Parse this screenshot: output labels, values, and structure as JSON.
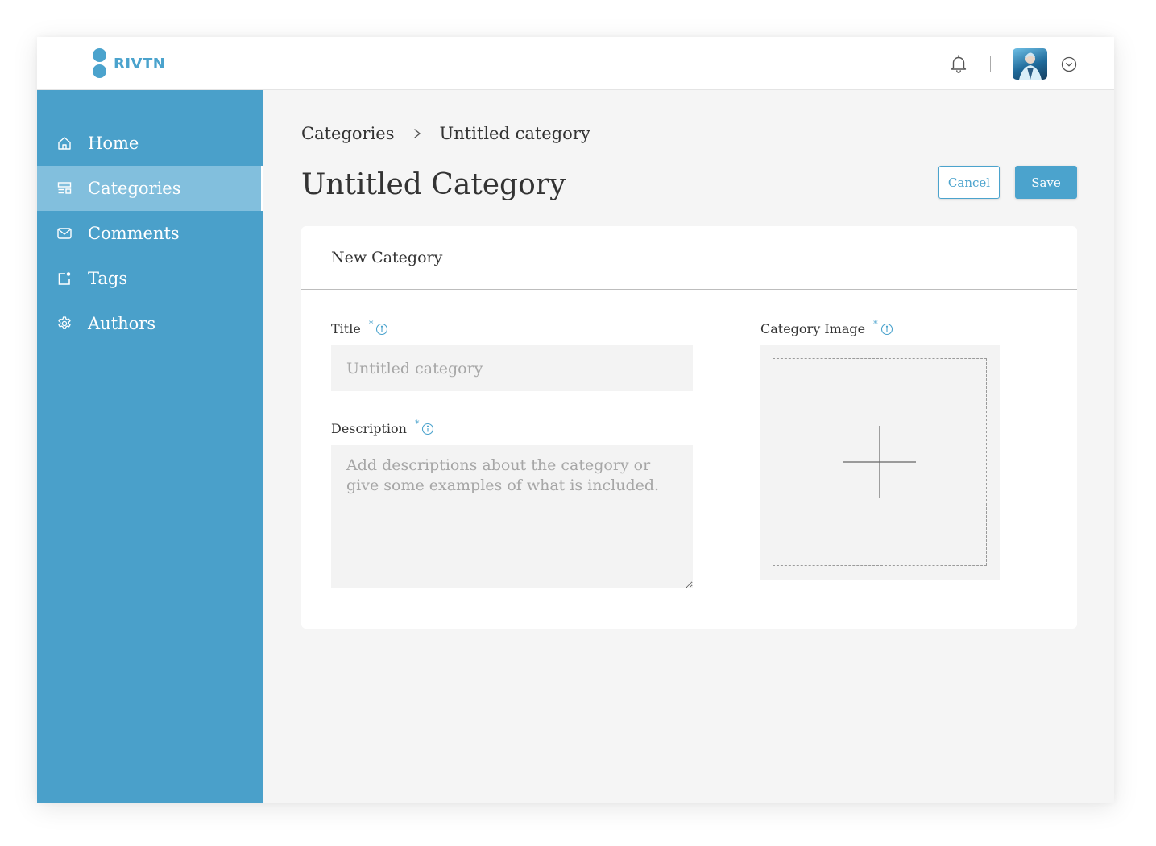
{
  "brand": {
    "name": "RIVTN",
    "color": "#4ba3cd"
  },
  "header": {
    "notifications_icon": "bell-icon",
    "avatar_icon": "user-avatar",
    "menu_icon": "chevron-down-circle-icon"
  },
  "sidebar": {
    "items": [
      {
        "label": "Home",
        "icon": "home-icon",
        "active": false
      },
      {
        "label": "Categories",
        "icon": "categories-icon",
        "active": true
      },
      {
        "label": "Comments",
        "icon": "mail-icon",
        "active": false
      },
      {
        "label": "Tags",
        "icon": "tag-icon",
        "active": false
      },
      {
        "label": "Authors",
        "icon": "gear-icon",
        "active": false
      }
    ]
  },
  "breadcrumb": {
    "parent": "Categories",
    "current": "Untitled category"
  },
  "page": {
    "title": "Untitled Category"
  },
  "actions": {
    "cancel_label": "Cancel",
    "save_label": "Save"
  },
  "form": {
    "card_title": "New Category",
    "title_field": {
      "label": "Title",
      "required_mark": "*",
      "placeholder": "Untitled category",
      "value": ""
    },
    "description_field": {
      "label": "Description",
      "required_mark": "*",
      "placeholder": "Add descriptions about the category or give some examples of what is included.",
      "value": ""
    },
    "image_field": {
      "label": "Category Image",
      "required_mark": "*",
      "icon": "plus-icon"
    }
  },
  "colors": {
    "sidebar": "#4aa0ca",
    "sidebar_active": "#82bfdd",
    "accent": "#4ba3cd"
  }
}
